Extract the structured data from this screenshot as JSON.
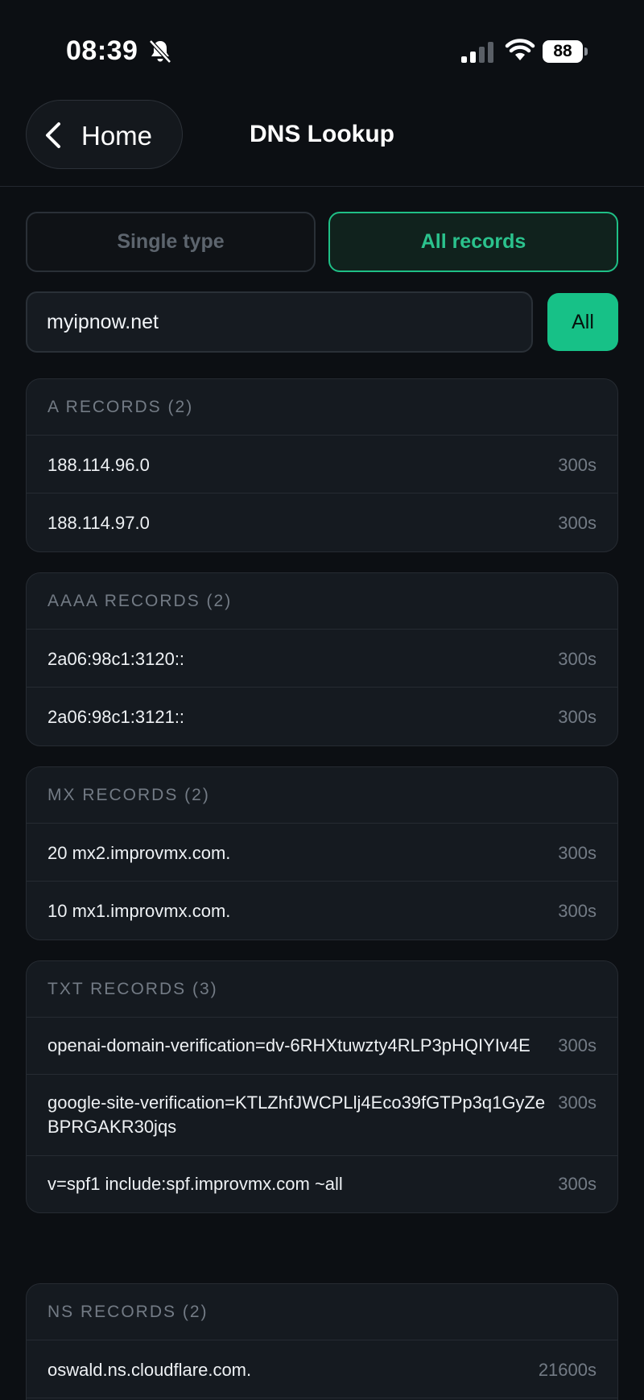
{
  "status": {
    "time": "08:39",
    "battery": "88"
  },
  "nav": {
    "back_label": "Home",
    "title": "DNS Lookup"
  },
  "segments": {
    "single": "Single type",
    "all": "All records"
  },
  "search": {
    "value": "myipnow.net",
    "button": "All"
  },
  "cards": [
    {
      "header": "A RECORDS (2)",
      "records": [
        {
          "value": "188.114.96.0",
          "ttl": "300s"
        },
        {
          "value": "188.114.97.0",
          "ttl": "300s"
        }
      ]
    },
    {
      "header": "AAAA RECORDS (2)",
      "records": [
        {
          "value": "2a06:98c1:3120::",
          "ttl": "300s"
        },
        {
          "value": "2a06:98c1:3121::",
          "ttl": "300s"
        }
      ]
    },
    {
      "header": "MX RECORDS (2)",
      "records": [
        {
          "value": "20 mx2.improvmx.com.",
          "ttl": "300s"
        },
        {
          "value": "10 mx1.improvmx.com.",
          "ttl": "300s"
        }
      ]
    },
    {
      "header": "TXT RECORDS (3)",
      "records": [
        {
          "value": "openai-domain-verification=dv-6RHXtuwzty4RLP3pHQIYIv4E",
          "ttl": "300s"
        },
        {
          "value": "google-site-verification=KTLZhfJWCPLlj4Eco39fGTPp3q1GyZeBPRGAKR30jqs",
          "ttl": "300s"
        },
        {
          "value": "v=spf1 include:spf.improvmx.com ~all",
          "ttl": "300s"
        }
      ]
    },
    {
      "header": "NS RECORDS (2)",
      "records": [
        {
          "value": "oswald.ns.cloudflare.com.",
          "ttl": "21600s"
        }
      ]
    }
  ]
}
